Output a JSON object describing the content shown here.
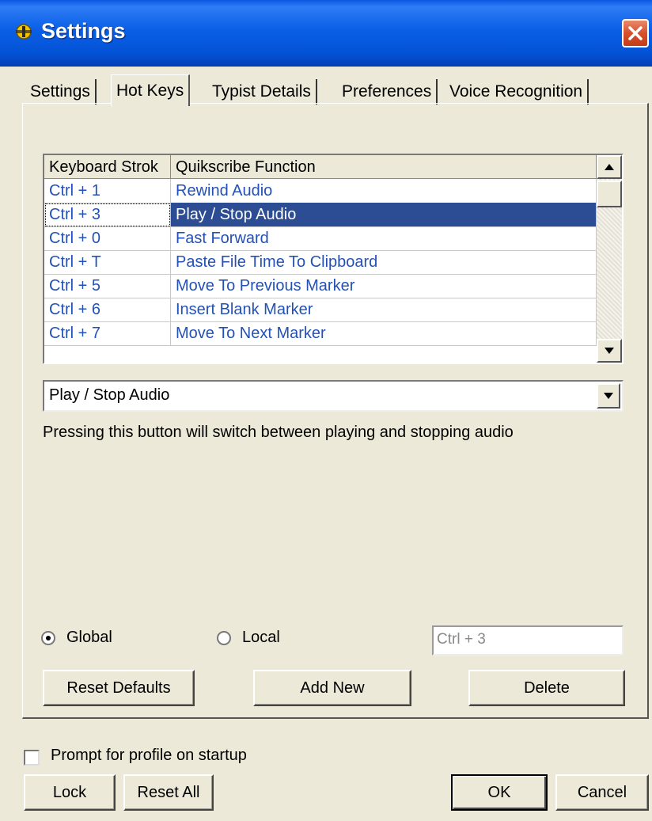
{
  "window": {
    "title": "Settings",
    "close_icon": "close-icon",
    "app_icon": "quikscribe-app-icon"
  },
  "tabs": [
    {
      "label": "Settings",
      "active": false
    },
    {
      "label": "Hot Keys",
      "active": true
    },
    {
      "label": "Typist Details",
      "active": false
    },
    {
      "label": "Preferences",
      "active": false
    },
    {
      "label": "Voice Recognition",
      "active": false
    }
  ],
  "hotkeys": {
    "columns": [
      "Keyboard Strok",
      "Quikscribe Function"
    ],
    "rows": [
      {
        "key": "Ctrl + 1",
        "function": "Rewind Audio"
      },
      {
        "key": "Ctrl + 3",
        "function": "Play / Stop Audio"
      },
      {
        "key": "Ctrl + 0",
        "function": "Fast Forward"
      },
      {
        "key": "Ctrl + T",
        "function": "Paste File Time To Clipboard"
      },
      {
        "key": "Ctrl + 5",
        "function": "Move To Previous Marker"
      },
      {
        "key": "Ctrl + 6",
        "function": "Insert Blank Marker"
      },
      {
        "key": "Ctrl + 7",
        "function": "Move To Next Marker"
      }
    ],
    "selected_index": 1,
    "function_select_value": "Play / Stop Audio",
    "description": "Pressing this button will switch between playing and stopping audio",
    "scope_options": [
      {
        "label": "Global",
        "checked": true
      },
      {
        "label": "Local",
        "checked": false
      }
    ],
    "key_field_value": "Ctrl + 3",
    "buttons": {
      "reset_defaults": "Reset Defaults",
      "add_new": "Add New",
      "delete": "Delete"
    }
  },
  "footer": {
    "prompt_checkbox_label": "Prompt for profile on startup",
    "prompt_checked": false,
    "lock": "Lock",
    "reset_all": "Reset All",
    "ok": "OK",
    "cancel": "Cancel"
  },
  "colors": {
    "titlebar": "#0a5fe6",
    "selection": "#2c4c94",
    "row_text": "#2351b6",
    "dialog_bg": "#ece9d8"
  }
}
